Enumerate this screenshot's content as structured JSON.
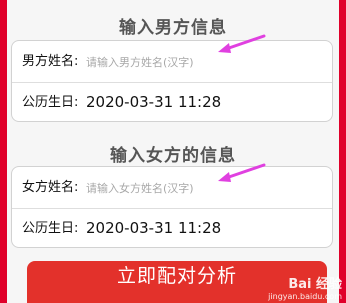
{
  "male_section": {
    "title": "输入男方信息",
    "name_label": "男方姓名:",
    "name_placeholder": "请输入男方姓名(汉字)",
    "birth_label": "公历生日:",
    "birth_value": "2020-03-31 11:28"
  },
  "female_section": {
    "title": "输入女方的信息",
    "name_label": "女方姓名:",
    "name_placeholder": "请输入女方姓名(汉字)",
    "birth_label": "公历生日:",
    "birth_value": "2020-03-31 11:28"
  },
  "submit_button": "立即配对分析",
  "watermark": {
    "name": "Bai 经验",
    "url": "jingyan.baidu.com"
  },
  "colors": {
    "accent_red": "#e3312b",
    "arrow_magenta": "#e040e0"
  }
}
